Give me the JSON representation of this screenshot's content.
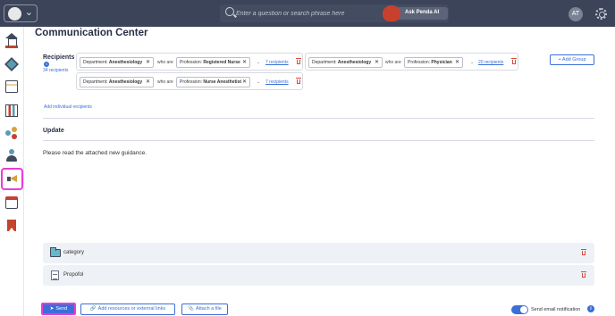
{
  "header": {
    "search_placeholder": "Enter a question or search phrase here",
    "ask_ai_label": "Ask Penda AI",
    "avatar_initials": "AT"
  },
  "sidebar": {
    "items": [
      {
        "icon": "home-icon"
      },
      {
        "icon": "cube-icon"
      },
      {
        "icon": "document-edit-icon"
      },
      {
        "icon": "chart-board-icon"
      },
      {
        "icon": "network-icon"
      },
      {
        "icon": "people-icon"
      },
      {
        "icon": "megaphone-icon",
        "active": true
      },
      {
        "icon": "calendar-icon"
      },
      {
        "icon": "bookmark-icon"
      }
    ]
  },
  "page": {
    "title": "Communication Center"
  },
  "recipients": {
    "label": "Recipients",
    "info": "i",
    "count": "34 recipients",
    "who_are": "who are",
    "rules": [
      {
        "department_key": "Department:",
        "department": "Anesthesiology",
        "profession_key": "Profession:",
        "profession": "Registered Nurse",
        "count": "7 recipients"
      },
      {
        "department_key": "Department:",
        "department": "Anesthesiology",
        "profession_key": "Profession:",
        "profession": "Physician",
        "count": "20 recipients"
      },
      {
        "department_key": "Department:",
        "department": "Anesthesiology",
        "profession_key": "Profession:",
        "profession": "Nurse Anesthetist",
        "count": "7 recipients"
      }
    ],
    "add_group": "+ Add Group",
    "add_individual": "Add individual recipients"
  },
  "message": {
    "subject": "Update",
    "body": "Please read the attached new guidance."
  },
  "attachments": [
    {
      "label": "category",
      "icon": "folder-icon"
    },
    {
      "label": "Propofol",
      "icon": "file-icon"
    }
  ],
  "footer": {
    "send_label": "Send",
    "add_resources_label": "Add resources or external links",
    "attach_file_label": "Attach a file",
    "email_notification_label": "Send email notification",
    "email_notification_on": true,
    "info": "i"
  },
  "colors": {
    "topbar": "#3b4458",
    "accent": "#3a6fd8",
    "highlight": "#e63ed6",
    "danger": "#d94a3a"
  }
}
